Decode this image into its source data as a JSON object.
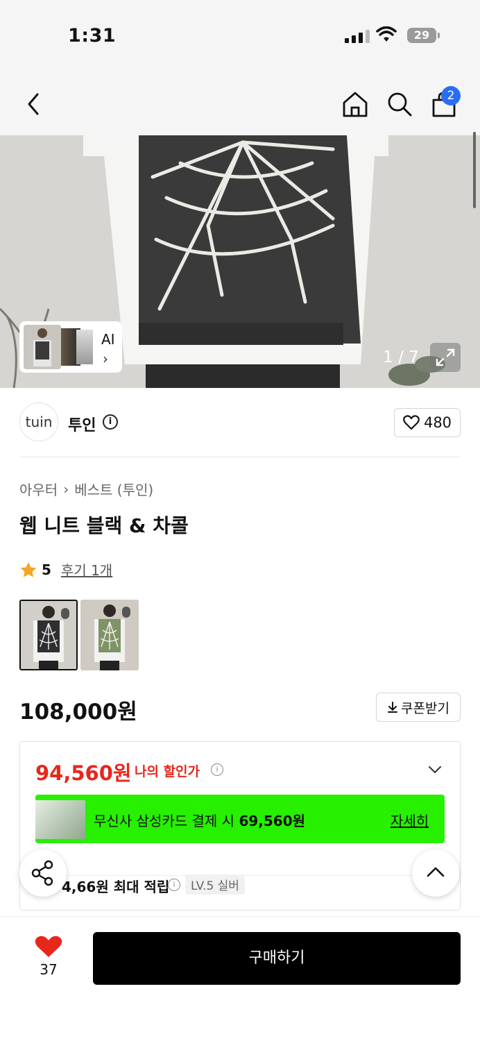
{
  "status_bar": {
    "time": "1:31",
    "battery": "29"
  },
  "nav": {
    "cart_badge": "2"
  },
  "hero": {
    "ai_label": "AI",
    "ai_chevron": "›",
    "counter": "1 / 7"
  },
  "brand": {
    "logo_text": "tuin",
    "name": "투인",
    "likes": "480"
  },
  "breadcrumb": {
    "category": "아우터",
    "separator": "›",
    "sub": "베스트 (투인)"
  },
  "product": {
    "title": "웹 니트 블랙 & 차콜",
    "rating": "5",
    "review_link": "후기 1개",
    "price": "108,000원",
    "coupon_label": "쿠폰받기"
  },
  "discount": {
    "price": "94,560원",
    "label": "나의 할인가",
    "card_text_prefix": "무신사 삼성카드 결제 시 ",
    "card_price": "69,560원",
    "card_detail": "자세히",
    "points_text": "4,66원 최대 적립",
    "points_level": "LV.5 실버"
  },
  "bottom": {
    "wish_count": "37",
    "buy_label": "구매하기"
  },
  "colors": {
    "accent_red": "#e8271b",
    "badge_blue": "#2a6df5",
    "card_green": "#27f000",
    "star": "#f5a623"
  },
  "icons": [
    "back-icon",
    "home-icon",
    "search-icon",
    "bag-icon",
    "expand-icon",
    "heart-icon",
    "star-icon",
    "info-icon",
    "download-icon",
    "chevron-down-icon",
    "share-icon",
    "arrow-up-icon"
  ]
}
